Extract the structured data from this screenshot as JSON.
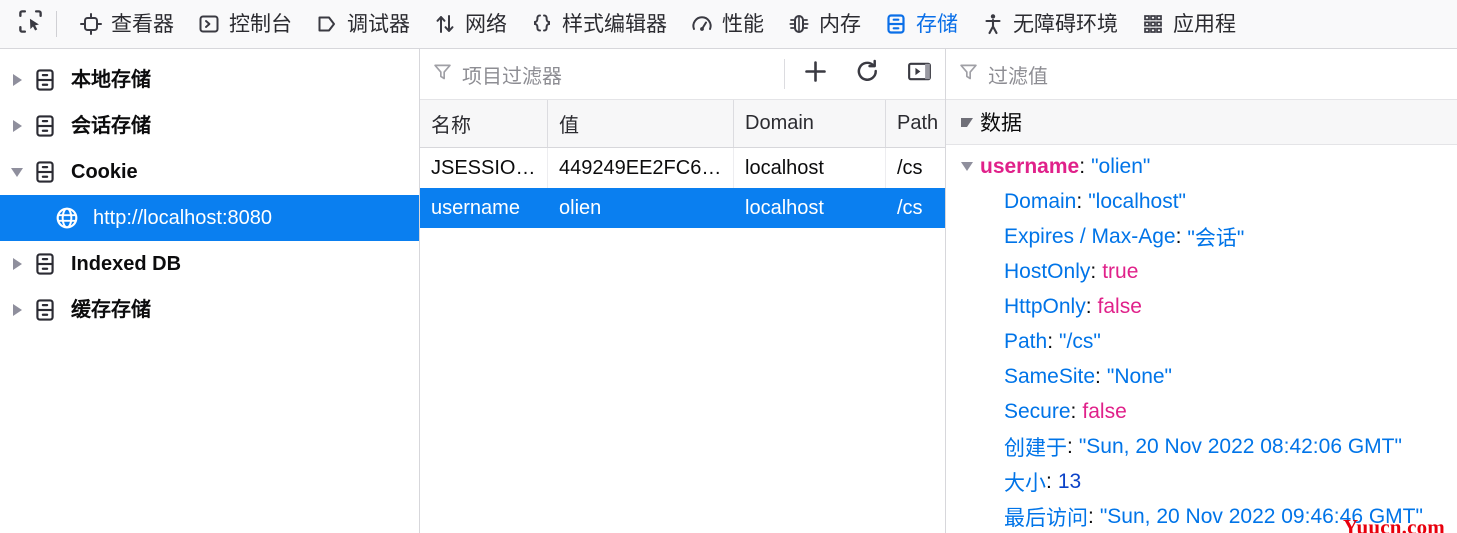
{
  "toolbar": {
    "picker_name": "element-picker",
    "active_tab": "存储",
    "tabs": [
      {
        "icon": "inspector-icon",
        "label": "查看器"
      },
      {
        "icon": "console-icon",
        "label": "控制台"
      },
      {
        "icon": "debugger-icon",
        "label": "调试器"
      },
      {
        "icon": "network-icon",
        "label": "网络"
      },
      {
        "icon": "style-editor-icon",
        "label": "样式编辑器"
      },
      {
        "icon": "performance-icon",
        "label": "性能"
      },
      {
        "icon": "memory-icon",
        "label": "内存"
      },
      {
        "icon": "storage-icon",
        "label": "存储"
      },
      {
        "icon": "accessibility-icon",
        "label": "无障碍环境"
      },
      {
        "icon": "application-icon",
        "label": "应用程"
      }
    ]
  },
  "sidebar": {
    "items": [
      {
        "label": "本地存储",
        "icon": "database-icon",
        "expanded": false,
        "selected": false,
        "child": false
      },
      {
        "label": "会话存储",
        "icon": "database-icon",
        "expanded": false,
        "selected": false,
        "child": false
      },
      {
        "label": "Cookie",
        "icon": "database-icon",
        "expanded": true,
        "selected": false,
        "child": false
      },
      {
        "label": "http://localhost:8080",
        "icon": "globe-icon",
        "expanded": false,
        "selected": true,
        "child": true
      },
      {
        "label": "Indexed DB",
        "icon": "database-icon",
        "expanded": false,
        "selected": false,
        "child": false
      },
      {
        "label": "缓存存储",
        "icon": "database-icon",
        "expanded": false,
        "selected": false,
        "child": false
      }
    ]
  },
  "table": {
    "filter_placeholder": "项目过滤器",
    "buttons": {
      "add": "add-icon",
      "refresh": "refresh-icon",
      "toggle_sidebar": "toggle-sidebar-icon"
    },
    "columns": [
      "名称",
      "值",
      "Domain",
      "Path"
    ],
    "rows": [
      {
        "name": "JSESSIO…",
        "value": "449249EE2FC6…",
        "domain": "localhost",
        "path": "/cs",
        "selected": false
      },
      {
        "name": "username",
        "value": "olien",
        "domain": "localhost",
        "path": "/cs",
        "selected": true
      }
    ]
  },
  "details": {
    "filter_placeholder": "过滤值",
    "section_title": "数据",
    "root": {
      "key": "username",
      "colon": ":",
      "value": "\"olien\""
    },
    "properties": [
      {
        "key": "Domain",
        "colon": ":",
        "value": "\"localhost\"",
        "type": "string"
      },
      {
        "key": "Expires / Max-Age",
        "colon": ":",
        "value": "\"会话\"",
        "type": "string"
      },
      {
        "key": "HostOnly",
        "colon": ":",
        "value": "true",
        "type": "bool"
      },
      {
        "key": "HttpOnly",
        "colon": ":",
        "value": "false",
        "type": "bool"
      },
      {
        "key": "Path",
        "colon": ":",
        "value": "\"/cs\"",
        "type": "string"
      },
      {
        "key": "SameSite",
        "colon": ":",
        "value": "\"None\"",
        "type": "string"
      },
      {
        "key": "Secure",
        "colon": ":",
        "value": "false",
        "type": "bool"
      },
      {
        "key": "创建于",
        "colon": ":",
        "value": "\"Sun, 20 Nov 2022 08:42:06 GMT\"",
        "type": "string"
      },
      {
        "key": "大小",
        "colon": ":",
        "value": "13",
        "type": "number"
      },
      {
        "key": "最后访问",
        "colon": ":",
        "value": "\"Sun, 20 Nov 2022 09:46:46 GMT\"",
        "type": "string"
      }
    ]
  },
  "watermark": {
    "text": "Yuucn.com",
    "color": "#e8000d"
  },
  "colors": {
    "selection_blue": "#0a7ff0",
    "tab_active_blue": "#0a6fe8",
    "key_blue": "#0074e8",
    "magenta": "#e0218a",
    "number_blue": "#0b42c8"
  }
}
